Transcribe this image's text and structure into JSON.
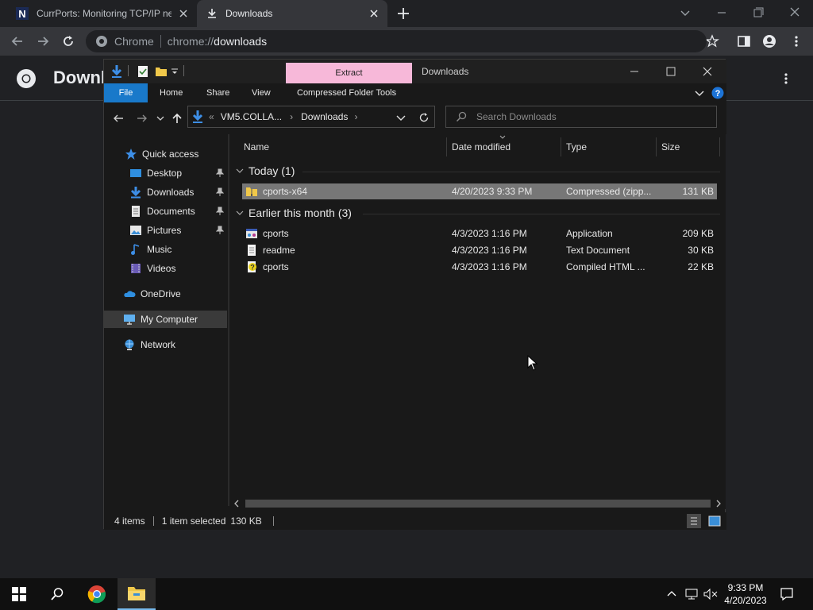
{
  "chrome": {
    "tabs": [
      {
        "title": "CurrPorts: Monitoring TCP/IP net",
        "icon": "nirsoft-icon"
      },
      {
        "title": "Downloads",
        "icon": "download-icon",
        "active": true
      }
    ],
    "omnibox": {
      "site_chip": "Chrome",
      "url_scheme": "chrome://",
      "url_host": "downloads"
    },
    "page_title": "Downloads"
  },
  "explorer": {
    "title": "Downloads",
    "contextual_tab": "Extract",
    "ribbon_tabs": [
      "File",
      "Home",
      "Share",
      "View",
      "Compressed Folder Tools"
    ],
    "address": {
      "root": "VM5.COLLA...",
      "current": "Downloads"
    },
    "search_placeholder": "Search Downloads",
    "nav": {
      "quick_access": "Quick access",
      "items": [
        {
          "label": "Desktop",
          "icon": "desktop-icon",
          "pinned": true
        },
        {
          "label": "Downloads",
          "icon": "download-arrow-icon",
          "pinned": true
        },
        {
          "label": "Documents",
          "icon": "documents-icon",
          "pinned": true
        },
        {
          "label": "Pictures",
          "icon": "pictures-icon",
          "pinned": true
        },
        {
          "label": "Music",
          "icon": "music-icon",
          "pinned": false
        },
        {
          "label": "Videos",
          "icon": "videos-icon",
          "pinned": false
        }
      ],
      "onedrive": "OneDrive",
      "my_computer": "My Computer",
      "network": "Network"
    },
    "columns": {
      "name": "Name",
      "date": "Date modified",
      "type": "Type",
      "size": "Size"
    },
    "groups": [
      {
        "label": "Today (1)",
        "files": [
          {
            "name": "cports-x64",
            "date": "4/20/2023 9:33 PM",
            "type": "Compressed (zipp...",
            "size": "131 KB",
            "selected": true,
            "icon": "zip-folder-icon"
          }
        ]
      },
      {
        "label": "Earlier this month (3)",
        "files": [
          {
            "name": "cports",
            "date": "4/3/2023 1:16 PM",
            "type": "Application",
            "size": "209 KB",
            "icon": "application-icon"
          },
          {
            "name": "readme",
            "date": "4/3/2023 1:16 PM",
            "type": "Text Document",
            "size": "30 KB",
            "icon": "text-file-icon"
          },
          {
            "name": "cports",
            "date": "4/3/2023 1:16 PM",
            "type": "Compiled HTML ...",
            "size": "22 KB",
            "icon": "chm-help-icon"
          }
        ]
      }
    ],
    "status": {
      "items": "4 items",
      "selected": "1 item selected",
      "size": "130 KB"
    }
  },
  "taskbar": {
    "time": "9:33 PM",
    "date": "4/20/2023"
  }
}
